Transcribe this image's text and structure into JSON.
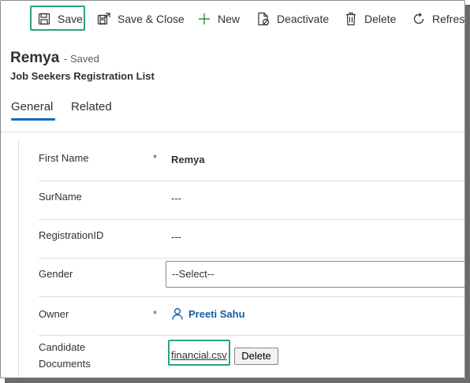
{
  "toolbar": {
    "save": "Save",
    "save_close": "Save & Close",
    "new": "New",
    "deactivate": "Deactivate",
    "delete": "Delete",
    "refresh": "Refresh"
  },
  "record": {
    "title": "Remya",
    "status": "- Saved",
    "entity": "Job Seekers Registration List"
  },
  "tabs": [
    "General",
    "Related"
  ],
  "form": {
    "first_name": {
      "label": "First Name",
      "required_mark": "*",
      "value": "Remya"
    },
    "surname": {
      "label": "SurName",
      "value": "---"
    },
    "registration_id": {
      "label": "RegistrationID",
      "value": "---"
    },
    "gender": {
      "label": "Gender",
      "value": "--Select--"
    },
    "owner": {
      "label": "Owner",
      "required_mark": "*",
      "value": "Preeti Sahu"
    },
    "candidate_documents": {
      "label_line1": "Candidate",
      "label_line2": "Documents",
      "file_name": "financial.csv",
      "delete_label": "Delete"
    }
  },
  "colors": {
    "highlight": "#2aa187",
    "accent": "#0f6cbd",
    "link": "#115ea3",
    "required": "#a4262c"
  },
  "icons": [
    "save-icon",
    "save-close-icon",
    "add-icon",
    "deactivate-icon",
    "delete-icon",
    "refresh-icon",
    "person-icon"
  ]
}
